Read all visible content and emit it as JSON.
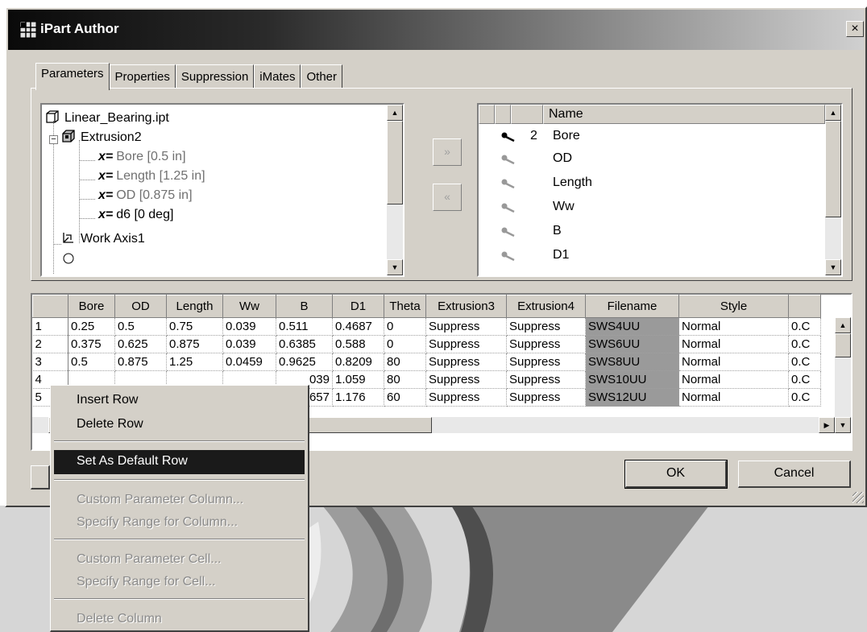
{
  "window": {
    "title": "iPart Author",
    "close_label": "×"
  },
  "tabs": [
    "Parameters",
    "Properties",
    "Suppression",
    "iMates",
    "Other"
  ],
  "tree": {
    "items": [
      {
        "label": "Linear_Bearing.ipt"
      },
      {
        "label": "Extrusion2"
      },
      {
        "prefix": "x=",
        "label": "Bore [0.5 in]"
      },
      {
        "prefix": "x=",
        "label": "Length [1.25 in]"
      },
      {
        "prefix": "x=",
        "label": "OD [0.875 in]"
      },
      {
        "prefix": "x=",
        "label": "d6 [0 deg]"
      },
      {
        "label": "Work Axis1"
      }
    ]
  },
  "transfer_buttons": {
    "add": "»",
    "remove": "«"
  },
  "params": {
    "header": "Name",
    "rows": [
      {
        "num": "2",
        "name": "Bore"
      },
      {
        "num": "",
        "name": "OD"
      },
      {
        "num": "",
        "name": "Length"
      },
      {
        "num": "",
        "name": "Ww"
      },
      {
        "num": "",
        "name": "B"
      },
      {
        "num": "",
        "name": "D1"
      }
    ]
  },
  "grid": {
    "columns": [
      "Bore",
      "OD",
      "Length",
      "Ww",
      "B",
      "D1",
      "Theta",
      "Extrusion3",
      "Extrusion4",
      "Filename",
      "Style",
      ""
    ],
    "rows": [
      [
        "1",
        "0.25",
        "0.5",
        "0.75",
        "0.039",
        "0.511",
        "0.4687",
        "0",
        "Suppress",
        "Suppress",
        "SWS4UU",
        "Normal",
        "0.C"
      ],
      [
        "2",
        "0.375",
        "0.625",
        "0.875",
        "0.039",
        "0.6385",
        "0.588",
        "0",
        "Suppress",
        "Suppress",
        "SWS6UU",
        "Normal",
        "0.C"
      ],
      [
        "3",
        "0.5",
        "0.875",
        "1.25",
        "0.0459",
        "0.9625",
        "0.8209",
        "80",
        "Suppress",
        "Suppress",
        "SWS8UU",
        "Normal",
        "0.C"
      ],
      [
        "4",
        "",
        "",
        "",
        "",
        "039",
        "1.059",
        "80",
        "Suppress",
        "Suppress",
        "SWS10UU",
        "Normal",
        "0.C"
      ],
      [
        "5",
        "",
        "",
        "",
        "",
        "657",
        "1.176",
        "60",
        "Suppress",
        "Suppress",
        "SWS12UU",
        "Normal",
        "0.C"
      ]
    ]
  },
  "buttons": {
    "ok": "OK",
    "cancel": "Cancel"
  },
  "context_menu": {
    "items": [
      {
        "label": "Insert Row",
        "state": "enabled"
      },
      {
        "label": "Delete Row",
        "state": "enabled"
      },
      {
        "label": "Set As Default Row",
        "state": "highlighted"
      },
      {
        "label": "Custom Parameter Column...",
        "state": "disabled"
      },
      {
        "label": "Specify Range for Column...",
        "state": "disabled"
      },
      {
        "label": "Custom Parameter Cell...",
        "state": "disabled"
      },
      {
        "label": "Specify Range for Cell...",
        "state": "disabled"
      },
      {
        "label": "Delete Column",
        "state": "disabled"
      }
    ]
  },
  "colors": {
    "face": "#d4d0c8",
    "highlight": "#1a1a1a",
    "filename_cell": "#9a9a9a"
  }
}
